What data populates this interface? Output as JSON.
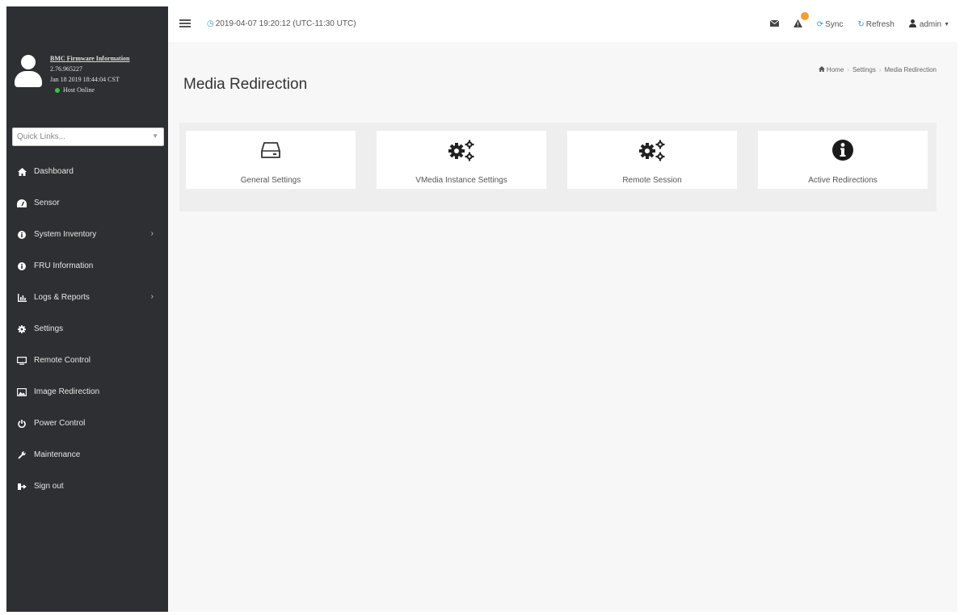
{
  "header": {
    "datetime": "2019-04-07 19:20:12 (UTC-11:30 UTC)",
    "sync_label": "Sync",
    "refresh_label": "Refresh",
    "user_label": "admin"
  },
  "sidebar": {
    "fw_title": "BMC Firmware Information",
    "fw_version": "2.76.965227",
    "fw_date": "Jan 18 2019 18:44:04 CST",
    "host_status": "Host Online",
    "quick_links_placeholder": "Quick Links...",
    "items": [
      {
        "label": "Dashboard",
        "icon": "home-icon"
      },
      {
        "label": "Sensor",
        "icon": "sensor-icon"
      },
      {
        "label": "System Inventory",
        "icon": "info-icon"
      },
      {
        "label": "FRU Information",
        "icon": "info-icon"
      },
      {
        "label": "Logs & Reports",
        "icon": "chart-icon"
      },
      {
        "label": "Settings",
        "icon": "gear-icon"
      },
      {
        "label": "Remote Control",
        "icon": "monitor-icon"
      },
      {
        "label": "Image Redirection",
        "icon": "image-icon"
      },
      {
        "label": "Power Control",
        "icon": "power-icon"
      },
      {
        "label": "Maintenance",
        "icon": "wrench-icon"
      },
      {
        "label": "Sign out",
        "icon": "sign-out-icon"
      }
    ]
  },
  "page": {
    "title": "Media Redirection",
    "breadcrumb": [
      "Home",
      "Settings",
      "Media Redirection"
    ]
  },
  "cards": [
    {
      "label": "General Settings",
      "icon": "hard-drive-icon"
    },
    {
      "label": "VMedia Instance Settings",
      "icon": "gears-icon"
    },
    {
      "label": "Remote Session",
      "icon": "gears-icon"
    },
    {
      "label": "Active Redirections",
      "icon": "info-circle-icon"
    }
  ],
  "colors": {
    "sidebar_bg": "#2d2f32",
    "accent_blue": "#3a9bd6",
    "badge": "#f0a030",
    "host_online": "#3cbf4a"
  }
}
